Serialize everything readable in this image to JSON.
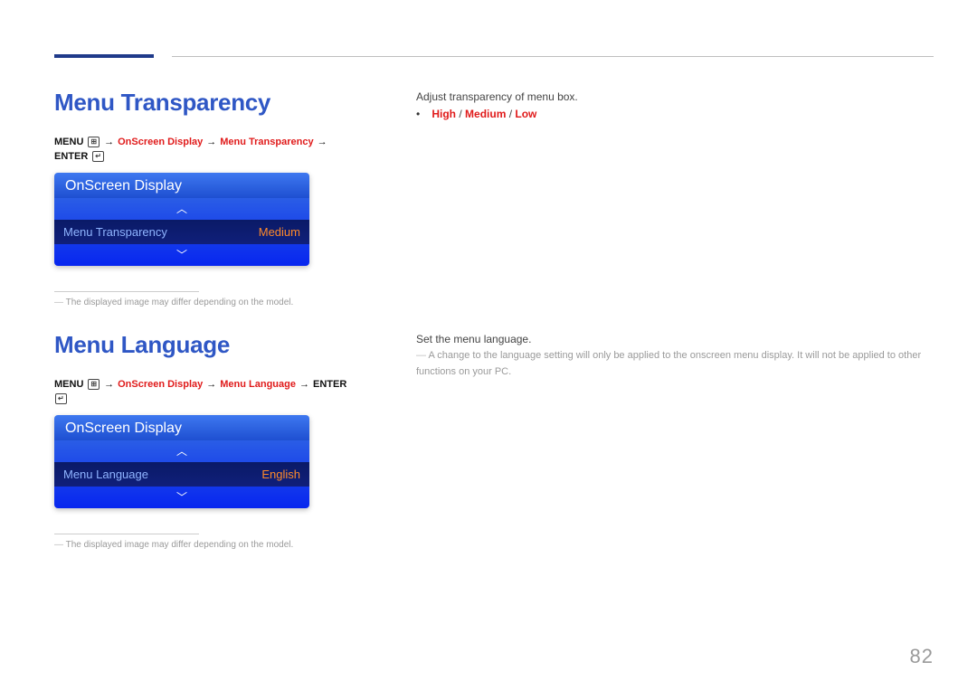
{
  "page_number": "82",
  "sections": [
    {
      "heading": "Menu Transparency",
      "path": {
        "menu_label": "MENU",
        "menu_glyph": "⊞",
        "arrow": "→",
        "seg1": "OnScreen Display",
        "seg2": "Menu Transparency",
        "enter_label": "ENTER",
        "enter_glyph": "↵"
      },
      "osd": {
        "title": "OnScreen Display",
        "row_label": "Menu Transparency",
        "row_value": "Medium"
      },
      "footnote": "The displayed image may differ depending on the model.",
      "right": {
        "desc": "Adjust transparency of menu box.",
        "options": [
          "High",
          "Medium",
          "Low"
        ]
      }
    },
    {
      "heading": "Menu Language",
      "path": {
        "menu_label": "MENU",
        "menu_glyph": "⊞",
        "arrow": "→",
        "seg1": "OnScreen Display",
        "seg2": "Menu Language",
        "enter_label": "ENTER",
        "enter_glyph": "↵"
      },
      "osd": {
        "title": "OnScreen Display",
        "row_label": "Menu Language",
        "row_value": "English"
      },
      "footnote": "The displayed image may differ depending on the model.",
      "right": {
        "desc": "Set the menu language.",
        "note": "A change to the language setting will only be applied to the onscreen menu display. It will not be applied to other functions on your PC."
      }
    }
  ]
}
